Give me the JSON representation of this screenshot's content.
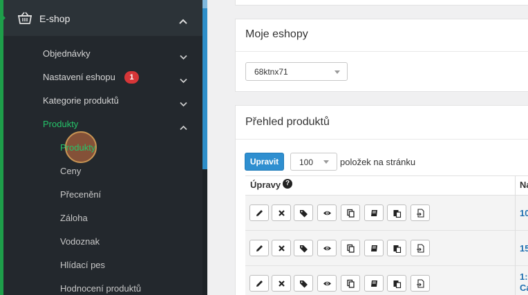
{
  "sidebar": {
    "eshop": {
      "label": "E-shop",
      "icon": "basket-icon"
    },
    "items": [
      {
        "label": "Objednávky"
      },
      {
        "label": "Nastavení eshopu",
        "badge": "1"
      },
      {
        "label": "Kategorie produktů"
      },
      {
        "label": "Produkty"
      }
    ],
    "subitems": [
      {
        "label": "Produkty"
      },
      {
        "label": "Ceny"
      },
      {
        "label": "Přecenění"
      },
      {
        "label": "Záloha"
      },
      {
        "label": "Vodoznak"
      },
      {
        "label": "Hlídací pes"
      },
      {
        "label": "Hodnocení produktů"
      }
    ],
    "colors": {
      "background": "#23282d",
      "active": "#25c56a",
      "accent": "#2d8ec9",
      "badge": "#d63638"
    }
  },
  "eshopy": {
    "title": "Moje eshopy",
    "selected": "68ktnx71"
  },
  "prehled": {
    "title": "Přehled produktů",
    "edit_button": "Upravit",
    "per_page_value": "100",
    "per_page_label": "položek na stránku",
    "columns": {
      "upravy": "Úpravy",
      "help": "?",
      "name": "Na"
    },
    "action_icons": [
      "pencil-icon",
      "close-icon",
      "tags-icon",
      "eye-icon",
      "copy-icon",
      "book-icon",
      "paste-icon",
      "file-export-icon"
    ],
    "rows": [
      {
        "name_partial": "10"
      },
      {
        "name_partial": "15"
      },
      {
        "name_partial": "1:",
        "name_partial_2": "Ca"
      }
    ]
  }
}
